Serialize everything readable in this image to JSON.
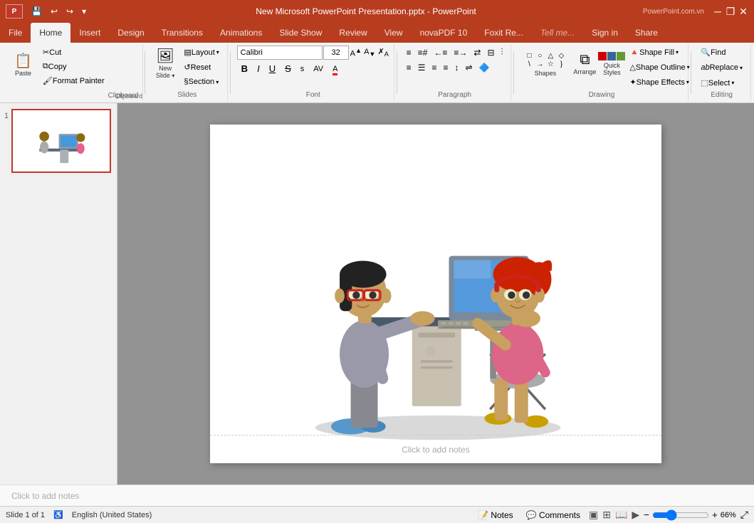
{
  "titleBar": {
    "title": "New Microsoft PowerPoint Presentation.pptx - PowerPoint",
    "quickAccess": [
      "save",
      "undo",
      "redo",
      "customize"
    ],
    "windowControls": [
      "minimize",
      "restore",
      "close"
    ],
    "logoText": "PL"
  },
  "ribbon": {
    "tabs": [
      "File",
      "Home",
      "Insert",
      "Design",
      "Transitions",
      "Animations",
      "Slide Show",
      "Review",
      "View",
      "novaPDF 10",
      "Foxit Re...",
      "Tell me...",
      "Sign in",
      "Share"
    ],
    "activeTab": "Home",
    "groups": {
      "clipboard": {
        "label": "Clipboard",
        "paste": "Paste",
        "cut": "Cut",
        "copy": "Copy",
        "formatPainter": "Format Painter"
      },
      "slides": {
        "label": "Slides",
        "newSlide": "New Slide",
        "layout": "Layout",
        "reset": "Reset",
        "section": "Section"
      },
      "font": {
        "label": "Font",
        "fontName": "Calibri",
        "fontSize": "32",
        "bold": "B",
        "italic": "I",
        "underline": "U",
        "strikethrough": "S",
        "shadowText": "s",
        "charSpacing": "AV",
        "fontColor": "A",
        "increaseFontSize": "A↑",
        "decreaseFontSize": "A↓",
        "clearFormatting": "✗"
      },
      "paragraph": {
        "label": "Paragraph",
        "bullets": "≡",
        "numbering": "≡#",
        "decreaseIndent": "←≡",
        "increaseIndent": "≡→",
        "textDirection": "⇄",
        "alignText": "⊟",
        "columns": "⫶",
        "lineSpacing": "↕",
        "alignLeft": "≡L",
        "alignCenter": "≡C",
        "alignRight": "≡R",
        "justify": "≡J"
      },
      "drawing": {
        "label": "Drawing",
        "shapes": "Shapes",
        "arrange": "Arrange",
        "quickStyles": "Quick Styles",
        "shapeFill": "Shape Fill",
        "shapeOutline": "Shape Outline",
        "shapeEffects": "Shape Effects"
      },
      "editing": {
        "label": "Editing",
        "find": "Find",
        "replace": "Replace",
        "select": "Select"
      }
    }
  },
  "slides": [
    {
      "number": "1",
      "thumbnail": "cartoon-computer-scene"
    }
  ],
  "mainSlide": {
    "clickToAddNotes": "Click to add notes"
  },
  "statusBar": {
    "slideInfo": "Slide 1 of 1",
    "language": "English (United States)",
    "notes": "Notes",
    "comments": "Comments",
    "zoomLevel": "66%",
    "viewButtons": [
      "normal",
      "slide-sorter",
      "reading",
      "slide-show"
    ]
  },
  "icons": {
    "save": "💾",
    "undo": "↩",
    "redo": "↪",
    "dropdown": "▾",
    "newSlide": "🖼",
    "paste": "📋",
    "cut": "✂",
    "copy": "⧉",
    "formatPainter": "🖌",
    "find": "🔍",
    "replace": "ab",
    "select": "⬚",
    "minimize": "─",
    "restore": "❐",
    "close": "✕",
    "notes": "📝",
    "comments": "💬",
    "normal": "▣",
    "slideSorter": "⊞",
    "reading": "📖",
    "slideShow": "▶",
    "zoomOut": "−",
    "zoomIn": "+",
    "fitSlide": "⤢",
    "shapeFill": "▲",
    "shapeOutline": "△",
    "shapeEffects": "✦"
  }
}
